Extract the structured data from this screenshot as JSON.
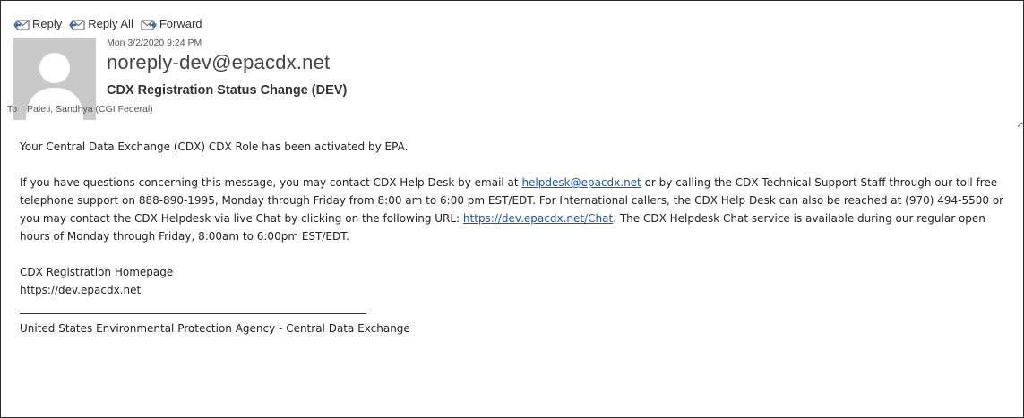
{
  "toolbar": {
    "reply_label": "Reply",
    "reply_all_label": "Reply All",
    "forward_label": "Forward"
  },
  "header": {
    "date": "Mon 3/2/2020 9:24 PM",
    "from": "noreply-dev@epacdx.net",
    "subject": "CDX Registration Status Change (DEV)",
    "to_label": "To",
    "to_value": "Paleti, Sandhya (CGI Federal)"
  },
  "message": {
    "line1": "Your Central Data Exchange (CDX) CDX Role has been activated by EPA.",
    "p2_a": "If you have questions concerning this message, you may contact CDX Help Desk by email at ",
    "p2_link_email": "helpdesk@epacdx.net",
    "p2_b": " or by calling the CDX Technical Support Staff through our toll free telephone support on  888-890-1995, Monday through Friday from 8:00 am to 6:00 pm EST/EDT. For International callers, the CDX Help Desk can also be reached at (970) 494-5500 or you may contact the CDX Helpdesk via live Chat by clicking on the following URL: ",
    "p2_link_chat": "https://dev.epacdx.net/Chat",
    "p2_c": ". The CDX Helpdesk Chat service is available during our regular open hours of Monday through Friday, 8:00am to 6:00pm EST/EDT.",
    "homepage_title": "CDX Registration Homepage",
    "homepage_url": "https://dev.epacdx.net",
    "signature": "United States Environmental Protection Agency - Central Data Exchange"
  },
  "colors": {
    "link": "#1155cc",
    "avatar_bg": "#c9c9c9",
    "icon_blue": "#3a78c3"
  },
  "icons": [
    "reply-icon",
    "reply-all-icon",
    "forward-icon",
    "avatar-person-icon",
    "chevron-up-icon"
  ]
}
